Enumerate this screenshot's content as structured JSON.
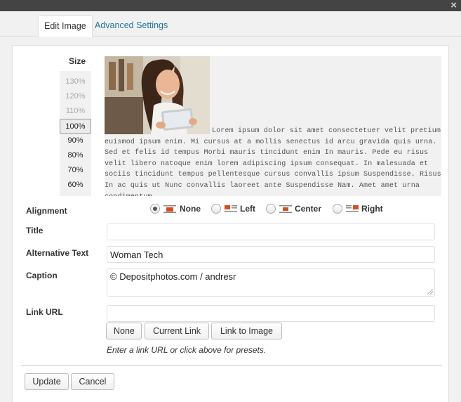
{
  "window": {
    "close_glyph": "×"
  },
  "tabs": [
    {
      "label": "Edit Image",
      "active": true
    },
    {
      "label": "Advanced Settings",
      "active": false
    }
  ],
  "size": {
    "title": "Size",
    "options": [
      "130%",
      "120%",
      "110%",
      "100%",
      "90%",
      "80%",
      "70%",
      "60%"
    ],
    "selected": "100%"
  },
  "preview": {
    "text": "Lorem ipsum dolor sit amet consectetuer velit pretium euismod ipsum enim. Mi cursus at a mollis senectus id arcu gravida quis urna. Sed et felis id tempus Morbi mauris tincidunt enim In mauris. Pede eu risus velit libero natoque enim lorem adipiscing ipsum consequat. In malesuada et sociis tincidunt tempus pellentesque cursus convallis ipsum Suspendisse. Risus In ac quis ut Nunc convallis laoreet ante Suspendisse Nam. Amet amet urna condimentum"
  },
  "alignment": {
    "label": "Alignment",
    "options": [
      {
        "label": "None",
        "icon": "align-none-icon",
        "checked": true
      },
      {
        "label": "Left",
        "icon": "align-left-icon",
        "checked": false
      },
      {
        "label": "Center",
        "icon": "align-center-icon",
        "checked": false
      },
      {
        "label": "Right",
        "icon": "align-right-icon",
        "checked": false
      }
    ]
  },
  "fields": {
    "title_label": "Title",
    "title_value": "",
    "alt_label": "Alternative Text",
    "alt_value": "Woman Tech",
    "caption_label": "Caption",
    "caption_value": "© Depositphotos.com / andresr",
    "link_label": "Link URL",
    "link_value": ""
  },
  "link_presets": {
    "none": "None",
    "current": "Current Link",
    "image": "Link to Image",
    "hint": "Enter a link URL or click above for presets."
  },
  "actions": {
    "update": "Update",
    "cancel": "Cancel"
  },
  "colors": {
    "accent": "#21759b",
    "icon_red": "#d54e21"
  }
}
